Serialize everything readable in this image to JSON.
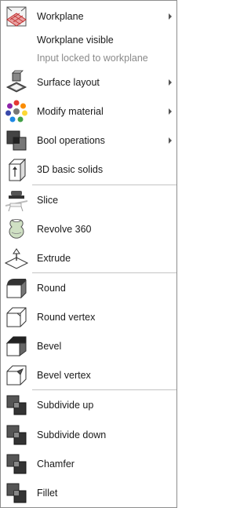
{
  "menu": {
    "items": [
      {
        "label": "Workplane",
        "icon": "workplane-icon",
        "submenu": true
      },
      {
        "label": "Workplane visible",
        "icon": null,
        "submenu": false
      },
      {
        "label": "Input locked to workplane",
        "icon": null,
        "submenu": false,
        "muted": true
      },
      {
        "label": "Surface layout",
        "icon": "surface-layout-icon",
        "submenu": true
      },
      {
        "label": "Modify material",
        "icon": "color-wheel-icon",
        "submenu": true
      },
      {
        "label": "Bool operations",
        "icon": "bool-operations-icon",
        "submenu": true
      },
      {
        "label": "3D basic solids",
        "icon": "basic-solids-icon",
        "submenu": false
      },
      {
        "label": "Slice",
        "icon": "slice-icon",
        "submenu": false
      },
      {
        "label": "Revolve 360",
        "icon": "revolve-icon",
        "submenu": false
      },
      {
        "label": "Extrude",
        "icon": "extrude-icon",
        "submenu": false
      },
      {
        "label": "Round",
        "icon": "round-icon",
        "submenu": false
      },
      {
        "label": "Round vertex",
        "icon": "round-vertex-icon",
        "submenu": false
      },
      {
        "label": "Bevel",
        "icon": "bevel-icon",
        "submenu": false
      },
      {
        "label": "Bevel vertex",
        "icon": "bevel-vertex-icon",
        "submenu": false
      },
      {
        "label": "Subdivide up",
        "icon": "subdivide-up-icon",
        "submenu": false
      },
      {
        "label": "Subdivide down",
        "icon": "subdivide-down-icon",
        "submenu": false
      },
      {
        "label": "Chamfer",
        "icon": "chamfer-icon",
        "submenu": false
      },
      {
        "label": "Fillet",
        "icon": "fillet-icon",
        "submenu": false
      }
    ]
  }
}
